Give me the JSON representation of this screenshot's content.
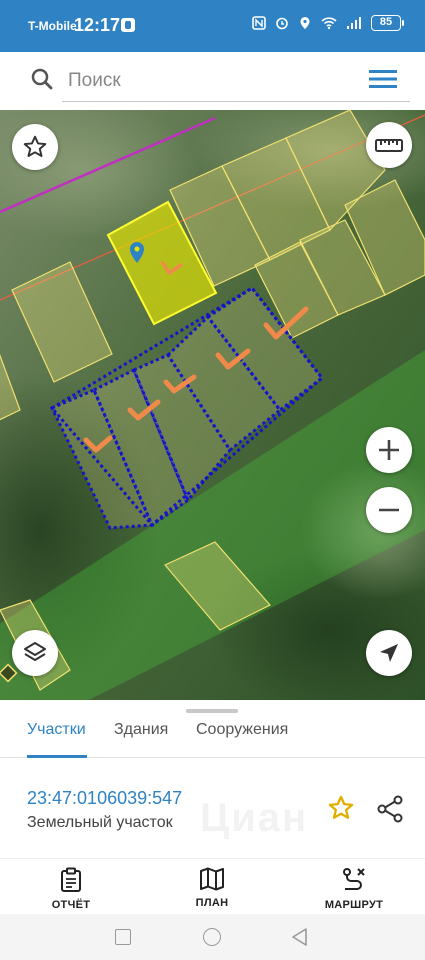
{
  "status_bar": {
    "carrier": "T-Mobile",
    "time": "12:17",
    "battery": "85"
  },
  "search": {
    "placeholder": "Поиск"
  },
  "tabs": [
    {
      "label": "Участки",
      "active": true
    },
    {
      "label": "Здания",
      "active": false
    },
    {
      "label": "Сооружения",
      "active": false
    }
  ],
  "parcel": {
    "number": "23:47:0106039:547",
    "type": "Земельный участок"
  },
  "watermark": "Циан",
  "bottom_nav": [
    {
      "label": "ОТЧЁТ",
      "icon": "report-icon"
    },
    {
      "label": "ПЛАН",
      "icon": "map-plan-icon"
    },
    {
      "label": "МАРШРУТ",
      "icon": "route-icon"
    }
  ],
  "map_controls": [
    "star-icon",
    "ruler-icon",
    "zoom-in-icon",
    "zoom-out-icon",
    "layers-icon",
    "locate-icon"
  ],
  "colors": {
    "accent": "#2f83c5",
    "selected_parcel": "#e6e600",
    "parcel_outline": "#f0e080",
    "dashed_outline": "#1414c8",
    "check_marks": "#f08a4b",
    "favorite_star": "#e0b000"
  }
}
